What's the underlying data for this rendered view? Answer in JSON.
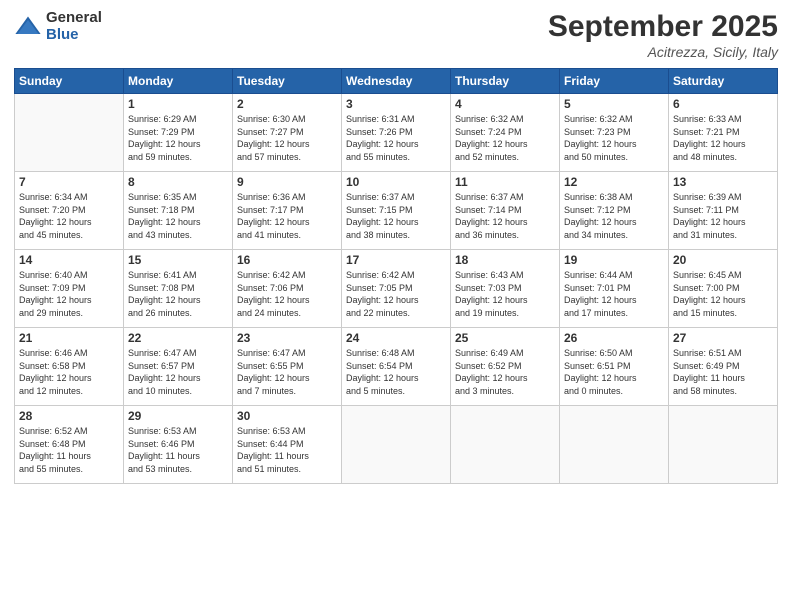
{
  "logo": {
    "general": "General",
    "blue": "Blue"
  },
  "header": {
    "month": "September 2025",
    "location": "Acitrezza, Sicily, Italy"
  },
  "weekdays": [
    "Sunday",
    "Monday",
    "Tuesday",
    "Wednesday",
    "Thursday",
    "Friday",
    "Saturday"
  ],
  "weeks": [
    [
      {
        "day": "",
        "info": ""
      },
      {
        "day": "1",
        "info": "Sunrise: 6:29 AM\nSunset: 7:29 PM\nDaylight: 12 hours\nand 59 minutes."
      },
      {
        "day": "2",
        "info": "Sunrise: 6:30 AM\nSunset: 7:27 PM\nDaylight: 12 hours\nand 57 minutes."
      },
      {
        "day": "3",
        "info": "Sunrise: 6:31 AM\nSunset: 7:26 PM\nDaylight: 12 hours\nand 55 minutes."
      },
      {
        "day": "4",
        "info": "Sunrise: 6:32 AM\nSunset: 7:24 PM\nDaylight: 12 hours\nand 52 minutes."
      },
      {
        "day": "5",
        "info": "Sunrise: 6:32 AM\nSunset: 7:23 PM\nDaylight: 12 hours\nand 50 minutes."
      },
      {
        "day": "6",
        "info": "Sunrise: 6:33 AM\nSunset: 7:21 PM\nDaylight: 12 hours\nand 48 minutes."
      }
    ],
    [
      {
        "day": "7",
        "info": "Sunrise: 6:34 AM\nSunset: 7:20 PM\nDaylight: 12 hours\nand 45 minutes."
      },
      {
        "day": "8",
        "info": "Sunrise: 6:35 AM\nSunset: 7:18 PM\nDaylight: 12 hours\nand 43 minutes."
      },
      {
        "day": "9",
        "info": "Sunrise: 6:36 AM\nSunset: 7:17 PM\nDaylight: 12 hours\nand 41 minutes."
      },
      {
        "day": "10",
        "info": "Sunrise: 6:37 AM\nSunset: 7:15 PM\nDaylight: 12 hours\nand 38 minutes."
      },
      {
        "day": "11",
        "info": "Sunrise: 6:37 AM\nSunset: 7:14 PM\nDaylight: 12 hours\nand 36 minutes."
      },
      {
        "day": "12",
        "info": "Sunrise: 6:38 AM\nSunset: 7:12 PM\nDaylight: 12 hours\nand 34 minutes."
      },
      {
        "day": "13",
        "info": "Sunrise: 6:39 AM\nSunset: 7:11 PM\nDaylight: 12 hours\nand 31 minutes."
      }
    ],
    [
      {
        "day": "14",
        "info": "Sunrise: 6:40 AM\nSunset: 7:09 PM\nDaylight: 12 hours\nand 29 minutes."
      },
      {
        "day": "15",
        "info": "Sunrise: 6:41 AM\nSunset: 7:08 PM\nDaylight: 12 hours\nand 26 minutes."
      },
      {
        "day": "16",
        "info": "Sunrise: 6:42 AM\nSunset: 7:06 PM\nDaylight: 12 hours\nand 24 minutes."
      },
      {
        "day": "17",
        "info": "Sunrise: 6:42 AM\nSunset: 7:05 PM\nDaylight: 12 hours\nand 22 minutes."
      },
      {
        "day": "18",
        "info": "Sunrise: 6:43 AM\nSunset: 7:03 PM\nDaylight: 12 hours\nand 19 minutes."
      },
      {
        "day": "19",
        "info": "Sunrise: 6:44 AM\nSunset: 7:01 PM\nDaylight: 12 hours\nand 17 minutes."
      },
      {
        "day": "20",
        "info": "Sunrise: 6:45 AM\nSunset: 7:00 PM\nDaylight: 12 hours\nand 15 minutes."
      }
    ],
    [
      {
        "day": "21",
        "info": "Sunrise: 6:46 AM\nSunset: 6:58 PM\nDaylight: 12 hours\nand 12 minutes."
      },
      {
        "day": "22",
        "info": "Sunrise: 6:47 AM\nSunset: 6:57 PM\nDaylight: 12 hours\nand 10 minutes."
      },
      {
        "day": "23",
        "info": "Sunrise: 6:47 AM\nSunset: 6:55 PM\nDaylight: 12 hours\nand 7 minutes."
      },
      {
        "day": "24",
        "info": "Sunrise: 6:48 AM\nSunset: 6:54 PM\nDaylight: 12 hours\nand 5 minutes."
      },
      {
        "day": "25",
        "info": "Sunrise: 6:49 AM\nSunset: 6:52 PM\nDaylight: 12 hours\nand 3 minutes."
      },
      {
        "day": "26",
        "info": "Sunrise: 6:50 AM\nSunset: 6:51 PM\nDaylight: 12 hours\nand 0 minutes."
      },
      {
        "day": "27",
        "info": "Sunrise: 6:51 AM\nSunset: 6:49 PM\nDaylight: 11 hours\nand 58 minutes."
      }
    ],
    [
      {
        "day": "28",
        "info": "Sunrise: 6:52 AM\nSunset: 6:48 PM\nDaylight: 11 hours\nand 55 minutes."
      },
      {
        "day": "29",
        "info": "Sunrise: 6:53 AM\nSunset: 6:46 PM\nDaylight: 11 hours\nand 53 minutes."
      },
      {
        "day": "30",
        "info": "Sunrise: 6:53 AM\nSunset: 6:44 PM\nDaylight: 11 hours\nand 51 minutes."
      },
      {
        "day": "",
        "info": ""
      },
      {
        "day": "",
        "info": ""
      },
      {
        "day": "",
        "info": ""
      },
      {
        "day": "",
        "info": ""
      }
    ]
  ]
}
